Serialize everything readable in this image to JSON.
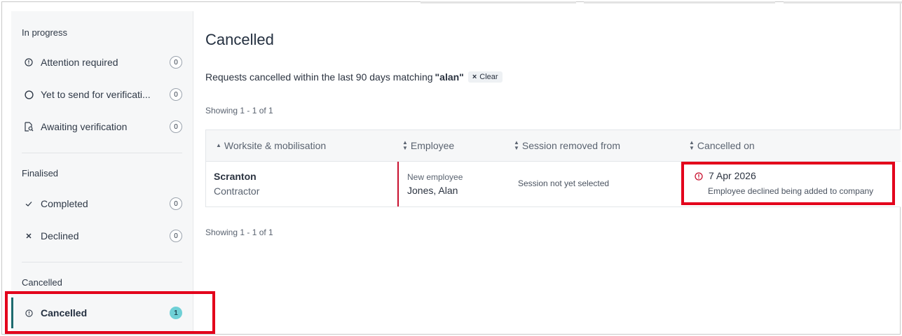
{
  "sidebar": {
    "in_progress_label": "In progress",
    "finalised_label": "Finalised",
    "cancelled_label": "Cancelled",
    "items": [
      {
        "label": "Attention required",
        "count": "0",
        "icon": "info-circle-icon"
      },
      {
        "label": "Yet to send for verificati...",
        "count": "0",
        "icon": "empty-circle-icon"
      },
      {
        "label": "Awaiting verification",
        "count": "0",
        "icon": "document-search-icon"
      },
      {
        "label": "Completed",
        "count": "0",
        "icon": "check-icon"
      },
      {
        "label": "Declined",
        "count": "0",
        "icon": "x-icon"
      },
      {
        "label": "Cancelled",
        "count": "1",
        "icon": "info-circle-icon"
      }
    ]
  },
  "main": {
    "title": "Cancelled",
    "filter_prefix": "Requests cancelled within the last 90 days matching",
    "filter_term": "\"alan\"",
    "clear_label": "Clear",
    "showing_top": "Showing 1 - 1 of 1",
    "showing_bottom": "Showing 1 - 1 of 1",
    "columns": [
      "Worksite & mobilisation",
      "Employee",
      "Session removed from",
      "Cancelled on"
    ],
    "rows": [
      {
        "worksite": "Scranton",
        "mobilisation": "Contractor",
        "employee_type": "New employee",
        "employee_name": "Jones, Alan",
        "session": "Session not yet selected",
        "cancelled_date": "7 Apr 2026",
        "cancel_reason": "Employee declined being added to company"
      }
    ]
  },
  "colors": {
    "accent": "#1e6b6f",
    "badge_active": "#6fd0d6",
    "alert_red": "#c8102e",
    "highlight": "#e3001b"
  }
}
